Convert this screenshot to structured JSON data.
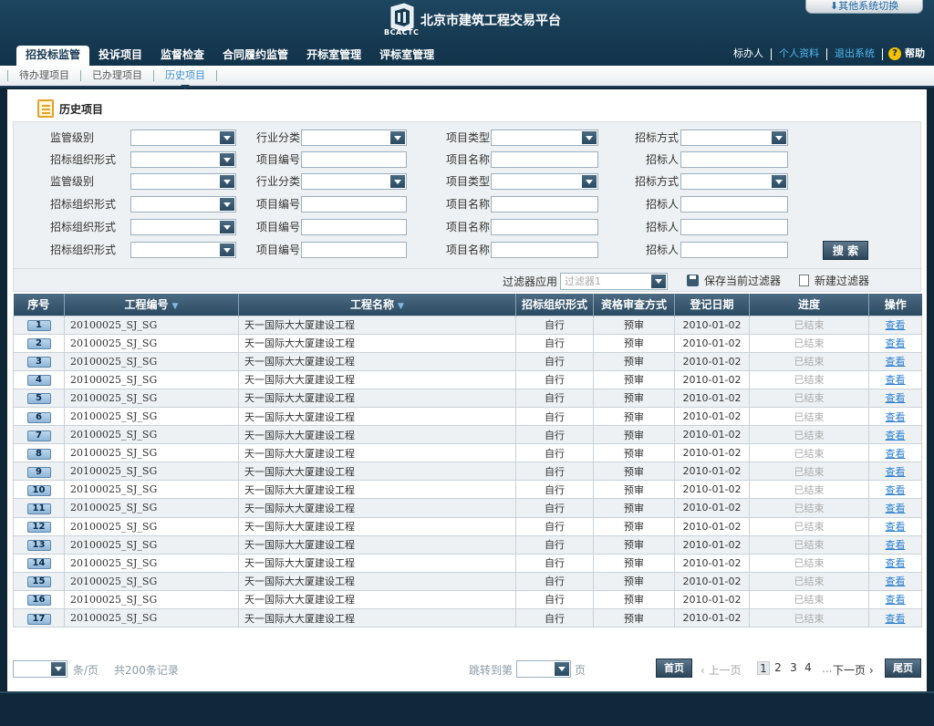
{
  "header": {
    "logo_text": "BCACTC",
    "site_title": "北京市建筑工程交易平台",
    "switch_label": "其他系统切换"
  },
  "nav": {
    "tabs": [
      "招投标监管",
      "投诉项目",
      "监督检查",
      "合同履约监管",
      "开标室管理",
      "评标室管理"
    ],
    "active_index": 0
  },
  "user_links": {
    "items": [
      "标办人",
      "个人资料",
      "退出系统"
    ],
    "help_icon_glyph": "?",
    "help": "帮助"
  },
  "subnav": {
    "tabs": [
      "待办理项目",
      "已办理项目",
      "历史项目"
    ],
    "active_index": 2
  },
  "section": {
    "title": "历史项目"
  },
  "filters": {
    "rows": [
      [
        "监管级别",
        "行业分类",
        "项目类型",
        "招标方式"
      ],
      [
        "招标组织形式",
        "项目编号",
        "项目名称",
        "招标人"
      ],
      [
        "监管级别",
        "行业分类",
        "项目类型",
        "招标方式"
      ],
      [
        "招标组织形式",
        "项目编号",
        "项目名称",
        "招标人"
      ],
      [
        "招标组织形式",
        "项目编号",
        "项目名称",
        "招标人"
      ],
      [
        "招标组织形式",
        "项目编号",
        "项目名称",
        "招标人"
      ]
    ],
    "search_button": "搜 索",
    "filter_apply_label": "过滤器应用",
    "filter_select_value": "过滤器1",
    "save_filter": "保存当前过滤器",
    "new_filter": "新建过滤器"
  },
  "table": {
    "columns": [
      "序号",
      "工程编号",
      "工程名称",
      "招标组织形式",
      "资格审查方式",
      "登记日期",
      "进度",
      "操作"
    ],
    "sort_arrow": "▼",
    "rows": [
      {
        "no": "1",
        "code": "20100025_SJ_SG",
        "name": "天一国际大大厦建设工程",
        "org": "自行",
        "review": "预审",
        "date": "2010-01-02",
        "progress": "已结束",
        "action": "查看"
      },
      {
        "no": "2",
        "code": "20100025_SJ_SG",
        "name": "天一国际大大厦建设工程",
        "org": "自行",
        "review": "预审",
        "date": "2010-01-02",
        "progress": "已结束",
        "action": "查看"
      },
      {
        "no": "3",
        "code": "20100025_SJ_SG",
        "name": "天一国际大大厦建设工程",
        "org": "自行",
        "review": "预审",
        "date": "2010-01-02",
        "progress": "已结束",
        "action": "查看"
      },
      {
        "no": "4",
        "code": "20100025_SJ_SG",
        "name": "天一国际大大厦建设工程",
        "org": "自行",
        "review": "预审",
        "date": "2010-01-02",
        "progress": "已结束",
        "action": "查看"
      },
      {
        "no": "5",
        "code": "20100025_SJ_SG",
        "name": "天一国际大大厦建设工程",
        "org": "自行",
        "review": "预审",
        "date": "2010-01-02",
        "progress": "已结束",
        "action": "查看"
      },
      {
        "no": "6",
        "code": "20100025_SJ_SG",
        "name": "天一国际大大厦建设工程",
        "org": "自行",
        "review": "预审",
        "date": "2010-01-02",
        "progress": "已结束",
        "action": "查看"
      },
      {
        "no": "7",
        "code": "20100025_SJ_SG",
        "name": "天一国际大大厦建设工程",
        "org": "自行",
        "review": "预审",
        "date": "2010-01-02",
        "progress": "已结束",
        "action": "查看"
      },
      {
        "no": "8",
        "code": "20100025_SJ_SG",
        "name": "天一国际大大厦建设工程",
        "org": "自行",
        "review": "预审",
        "date": "2010-01-02",
        "progress": "已结束",
        "action": "查看"
      },
      {
        "no": "9",
        "code": "20100025_SJ_SG",
        "name": "天一国际大大厦建设工程",
        "org": "自行",
        "review": "预审",
        "date": "2010-01-02",
        "progress": "已结束",
        "action": "查看"
      },
      {
        "no": "10",
        "code": "20100025_SJ_SG",
        "name": "天一国际大大厦建设工程",
        "org": "自行",
        "review": "预审",
        "date": "2010-01-02",
        "progress": "已结束",
        "action": "查看"
      },
      {
        "no": "11",
        "code": "20100025_SJ_SG",
        "name": "天一国际大大厦建设工程",
        "org": "自行",
        "review": "预审",
        "date": "2010-01-02",
        "progress": "已结束",
        "action": "查看"
      },
      {
        "no": "12",
        "code": "20100025_SJ_SG",
        "name": "天一国际大大厦建设工程",
        "org": "自行",
        "review": "预审",
        "date": "2010-01-02",
        "progress": "已结束",
        "action": "查看"
      },
      {
        "no": "13",
        "code": "20100025_SJ_SG",
        "name": "天一国际大大厦建设工程",
        "org": "自行",
        "review": "预审",
        "date": "2010-01-02",
        "progress": "已结束",
        "action": "查看"
      },
      {
        "no": "14",
        "code": "20100025_SJ_SG",
        "name": "天一国际大大厦建设工程",
        "org": "自行",
        "review": "预审",
        "date": "2010-01-02",
        "progress": "已结束",
        "action": "查看"
      },
      {
        "no": "15",
        "code": "20100025_SJ_SG",
        "name": "天一国际大大厦建设工程",
        "org": "自行",
        "review": "预审",
        "date": "2010-01-02",
        "progress": "已结束",
        "action": "查看"
      },
      {
        "no": "16",
        "code": "20100025_SJ_SG",
        "name": "天一国际大大厦建设工程",
        "org": "自行",
        "review": "预审",
        "date": "2010-01-02",
        "progress": "已结束",
        "action": "查看"
      },
      {
        "no": "17",
        "code": "20100025_SJ_SG",
        "name": "天一国际大大厦建设工程",
        "org": "自行",
        "review": "预审",
        "date": "2010-01-02",
        "progress": "已结束",
        "action": "查看"
      }
    ]
  },
  "pager": {
    "per_page_unit": "条/页",
    "total_records": "共200条记录",
    "jump_to": "跳转到第",
    "page_unit": "页",
    "first": "首页",
    "prev": "‹ 上一页",
    "pages": [
      "1",
      "2",
      "3",
      "4"
    ],
    "current_page": "1",
    "ellipsis": "...",
    "next": "下一页 ›",
    "last": "尾页"
  },
  "colors": {
    "header_bg": "#163a52",
    "accent_blue": "#4fb8f0",
    "link_blue": "#2a7fd0"
  }
}
